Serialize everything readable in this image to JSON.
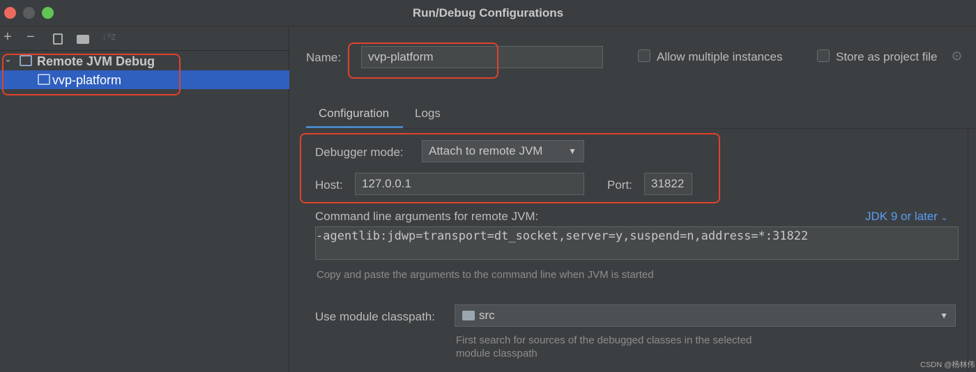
{
  "window": {
    "title": "Run/Debug Configurations"
  },
  "toolbar": {
    "add": "+",
    "remove": "−",
    "sort": "↓ᵃz"
  },
  "tree": {
    "group": "Remote JVM Debug",
    "item": "vvp-platform"
  },
  "form": {
    "name_label": "Name:",
    "name_value": "vvp-platform",
    "allow_multiple": "Allow multiple instances",
    "allow_multiple_checked": false,
    "store_project": "Store as project file",
    "store_project_checked": false,
    "tabs": [
      {
        "label": "Configuration",
        "active": true
      },
      {
        "label": "Logs",
        "active": false
      }
    ],
    "debugger_mode_label": "Debugger mode:",
    "debugger_mode_value": "Attach to remote JVM",
    "host_label": "Host:",
    "host_value": "127.0.0.1",
    "port_label": "Port:",
    "port_value": "31822",
    "cmd_label": "Command line arguments for remote JVM:",
    "jdk_link": "JDK 9 or later",
    "cmd_value": "-agentlib:jdwp=transport=dt_socket,server=y,suspend=n,address=*:31822",
    "cmd_hint": "Copy and paste the arguments to the command line when JVM is started",
    "classpath_label": "Use module classpath:",
    "classpath_value": "src",
    "classpath_hint_1": "First search for sources of the debugged classes in the selected",
    "classpath_hint_2": "module classpath"
  },
  "watermark": "CSDN @杨林伟",
  "colors": {
    "accent": "#2f5fbf",
    "highlight": "#e0432c",
    "link": "#589df6"
  }
}
